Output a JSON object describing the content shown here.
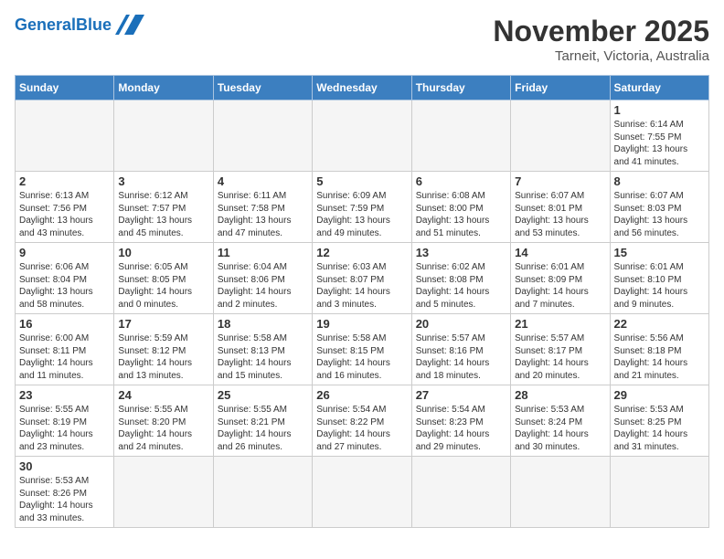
{
  "header": {
    "logo_general": "General",
    "logo_blue": "Blue",
    "month": "November 2025",
    "location": "Tarneit, Victoria, Australia"
  },
  "weekdays": [
    "Sunday",
    "Monday",
    "Tuesday",
    "Wednesday",
    "Thursday",
    "Friday",
    "Saturday"
  ],
  "weeks": [
    [
      {
        "day": "",
        "info": ""
      },
      {
        "day": "",
        "info": ""
      },
      {
        "day": "",
        "info": ""
      },
      {
        "day": "",
        "info": ""
      },
      {
        "day": "",
        "info": ""
      },
      {
        "day": "",
        "info": ""
      },
      {
        "day": "1",
        "info": "Sunrise: 6:14 AM\nSunset: 7:55 PM\nDaylight: 13 hours and 41 minutes."
      }
    ],
    [
      {
        "day": "2",
        "info": "Sunrise: 6:13 AM\nSunset: 7:56 PM\nDaylight: 13 hours and 43 minutes."
      },
      {
        "day": "3",
        "info": "Sunrise: 6:12 AM\nSunset: 7:57 PM\nDaylight: 13 hours and 45 minutes."
      },
      {
        "day": "4",
        "info": "Sunrise: 6:11 AM\nSunset: 7:58 PM\nDaylight: 13 hours and 47 minutes."
      },
      {
        "day": "5",
        "info": "Sunrise: 6:09 AM\nSunset: 7:59 PM\nDaylight: 13 hours and 49 minutes."
      },
      {
        "day": "6",
        "info": "Sunrise: 6:08 AM\nSunset: 8:00 PM\nDaylight: 13 hours and 51 minutes."
      },
      {
        "day": "7",
        "info": "Sunrise: 6:07 AM\nSunset: 8:01 PM\nDaylight: 13 hours and 53 minutes."
      },
      {
        "day": "8",
        "info": "Sunrise: 6:07 AM\nSunset: 8:03 PM\nDaylight: 13 hours and 56 minutes."
      }
    ],
    [
      {
        "day": "9",
        "info": "Sunrise: 6:06 AM\nSunset: 8:04 PM\nDaylight: 13 hours and 58 minutes."
      },
      {
        "day": "10",
        "info": "Sunrise: 6:05 AM\nSunset: 8:05 PM\nDaylight: 14 hours and 0 minutes."
      },
      {
        "day": "11",
        "info": "Sunrise: 6:04 AM\nSunset: 8:06 PM\nDaylight: 14 hours and 2 minutes."
      },
      {
        "day": "12",
        "info": "Sunrise: 6:03 AM\nSunset: 8:07 PM\nDaylight: 14 hours and 3 minutes."
      },
      {
        "day": "13",
        "info": "Sunrise: 6:02 AM\nSunset: 8:08 PM\nDaylight: 14 hours and 5 minutes."
      },
      {
        "day": "14",
        "info": "Sunrise: 6:01 AM\nSunset: 8:09 PM\nDaylight: 14 hours and 7 minutes."
      },
      {
        "day": "15",
        "info": "Sunrise: 6:01 AM\nSunset: 8:10 PM\nDaylight: 14 hours and 9 minutes."
      }
    ],
    [
      {
        "day": "16",
        "info": "Sunrise: 6:00 AM\nSunset: 8:11 PM\nDaylight: 14 hours and 11 minutes."
      },
      {
        "day": "17",
        "info": "Sunrise: 5:59 AM\nSunset: 8:12 PM\nDaylight: 14 hours and 13 minutes."
      },
      {
        "day": "18",
        "info": "Sunrise: 5:58 AM\nSunset: 8:13 PM\nDaylight: 14 hours and 15 minutes."
      },
      {
        "day": "19",
        "info": "Sunrise: 5:58 AM\nSunset: 8:15 PM\nDaylight: 14 hours and 16 minutes."
      },
      {
        "day": "20",
        "info": "Sunrise: 5:57 AM\nSunset: 8:16 PM\nDaylight: 14 hours and 18 minutes."
      },
      {
        "day": "21",
        "info": "Sunrise: 5:57 AM\nSunset: 8:17 PM\nDaylight: 14 hours and 20 minutes."
      },
      {
        "day": "22",
        "info": "Sunrise: 5:56 AM\nSunset: 8:18 PM\nDaylight: 14 hours and 21 minutes."
      }
    ],
    [
      {
        "day": "23",
        "info": "Sunrise: 5:55 AM\nSunset: 8:19 PM\nDaylight: 14 hours and 23 minutes."
      },
      {
        "day": "24",
        "info": "Sunrise: 5:55 AM\nSunset: 8:20 PM\nDaylight: 14 hours and 24 minutes."
      },
      {
        "day": "25",
        "info": "Sunrise: 5:55 AM\nSunset: 8:21 PM\nDaylight: 14 hours and 26 minutes."
      },
      {
        "day": "26",
        "info": "Sunrise: 5:54 AM\nSunset: 8:22 PM\nDaylight: 14 hours and 27 minutes."
      },
      {
        "day": "27",
        "info": "Sunrise: 5:54 AM\nSunset: 8:23 PM\nDaylight: 14 hours and 29 minutes."
      },
      {
        "day": "28",
        "info": "Sunrise: 5:53 AM\nSunset: 8:24 PM\nDaylight: 14 hours and 30 minutes."
      },
      {
        "day": "29",
        "info": "Sunrise: 5:53 AM\nSunset: 8:25 PM\nDaylight: 14 hours and 31 minutes."
      }
    ],
    [
      {
        "day": "30",
        "info": "Sunrise: 5:53 AM\nSunset: 8:26 PM\nDaylight: 14 hours and 33 minutes."
      },
      {
        "day": "",
        "info": ""
      },
      {
        "day": "",
        "info": ""
      },
      {
        "day": "",
        "info": ""
      },
      {
        "day": "",
        "info": ""
      },
      {
        "day": "",
        "info": ""
      },
      {
        "day": "",
        "info": ""
      }
    ]
  ]
}
